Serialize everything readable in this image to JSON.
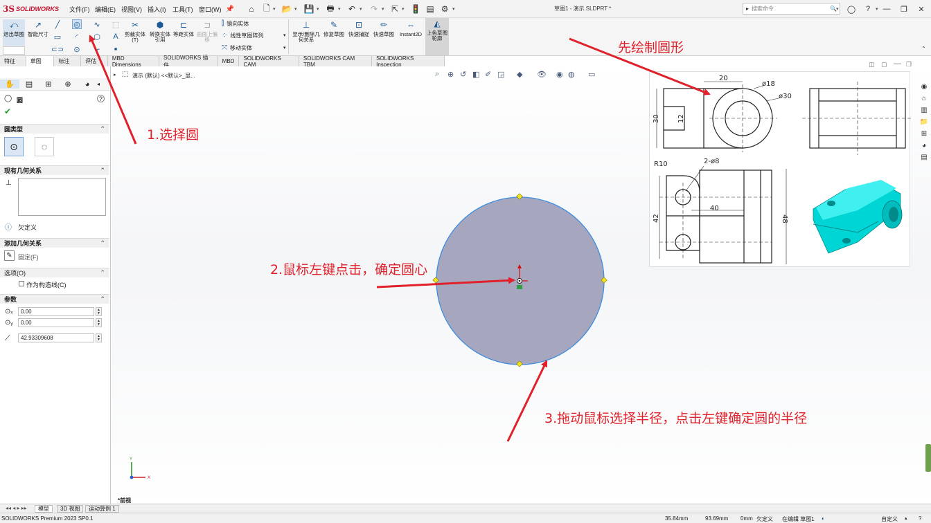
{
  "app": {
    "logo_ds": "3S",
    "logo_name": "SOLIDWORKS",
    "doc_title": "草图1 - 演示.SLDPRT *"
  },
  "menu": [
    "文件(F)",
    "编辑(E)",
    "视图(V)",
    "插入(I)",
    "工具(T)",
    "窗口(W)"
  ],
  "search": {
    "placeholder": "搜索命令"
  },
  "ribbon": {
    "exit_sketch": "退出草图",
    "smart_dim": "智能尺寸",
    "trim": "剪裁实体(T)",
    "convert": "转换实体引用",
    "offset": "等距实体",
    "surface_offset": "曲面上偏移",
    "mirror": "镜向实体",
    "linear_pattern": "线性草图阵列",
    "move": "移动实体",
    "show_delete": "显示/删除几何关系",
    "repair": "修复草图",
    "quick_snap": "快速捕捉",
    "rapid_sketch": "快速草图",
    "instant2d": "Instant2D",
    "shaded": "上色草图轮廓"
  },
  "tabs": [
    "特征",
    "草图",
    "标注",
    "评估",
    "MBD Dimensions",
    "SOLIDWORKS 插件",
    "MBD",
    "SOLIDWORKS CAM",
    "SOLIDWORKS CAM TBM",
    "SOLIDWORKS Inspection"
  ],
  "panel": {
    "title": "圆",
    "circle_type": "圆类型",
    "existing_relations": "现有几何关系",
    "underdefined": "欠定义",
    "add_relations": "添加几何关系",
    "fix": "固定(F)",
    "options": "选项(O)",
    "construction": "作为构造线(C)",
    "params": "参数",
    "cx": "0.00",
    "cy": "0.00",
    "radius": "42.93309608"
  },
  "breadcrumb": "演示 (默认) <<默认>_显...",
  "drawing": {
    "d20": "20",
    "d18": "ø18",
    "d30": "ø30",
    "d30v": "30",
    "d12": "12",
    "r10": "R10",
    "d2_8": "2-ø8",
    "d40": "40",
    "d42": "42",
    "d48": "48"
  },
  "annotations": {
    "a0": "先绘制圆形",
    "a1": "1.选择圆",
    "a2": "2.鼠标左键点击，确定圆心",
    "a3": "3.拖动鼠标选择半径，点击左键确定圆的半径"
  },
  "triad": {
    "x": "X",
    "y": "Y"
  },
  "view_label": "*前视",
  "bottom_tabs": [
    "模型",
    "3D 视图",
    "运动算例 1"
  ],
  "status": {
    "app": "SOLIDWORKS Premium 2023 SP0.1",
    "x": "35.84mm",
    "y": "93.69mm",
    "z": "0mm",
    "state": "欠定义",
    "editing": "在编辑 草图1",
    "units": "自定义"
  },
  "colors": {
    "accent": "#c8102e",
    "annotation": "#e0202a",
    "circle_fill": "#a6a7bf",
    "circle_edge": "#3c8ce0",
    "model_cyan": "#00e5e5"
  }
}
